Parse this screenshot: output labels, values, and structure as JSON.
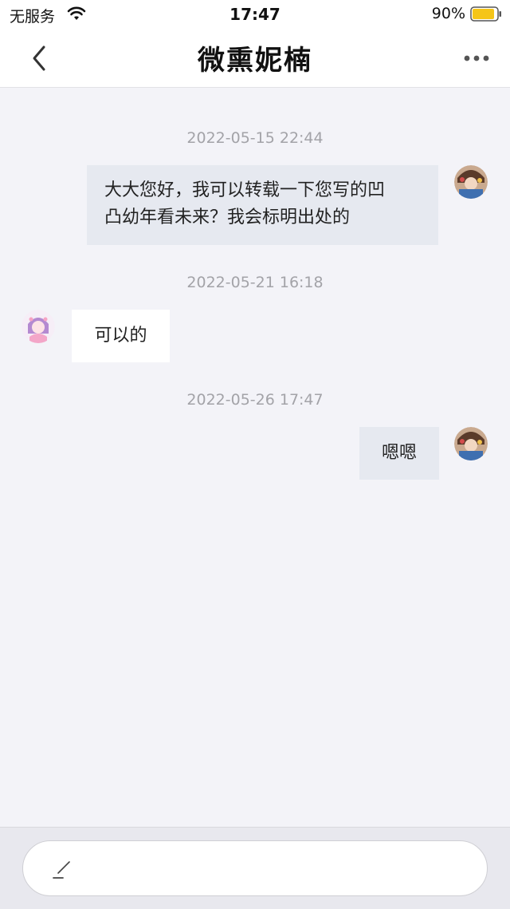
{
  "status_bar": {
    "carrier": "无服务",
    "time": "17:47",
    "battery_percent": "90%",
    "battery_level": 0.9,
    "battery_color": "#f5c518"
  },
  "nav": {
    "title": "微熏妮楠",
    "back_icon": "chevron-left-icon",
    "more_icon": "ellipsis-icon"
  },
  "messages": [
    {
      "timestamp": "2022-05-15 22:44",
      "direction": "out",
      "lines": [
        "大大您好，我可以转载一下您写的凹",
        "凸幼年看未来？我会标明出处的"
      ]
    },
    {
      "timestamp": "2022-05-21 16:18",
      "direction": "in",
      "lines": [
        "可以的"
      ]
    },
    {
      "timestamp": "2022-05-26 17:47",
      "direction": "out",
      "lines": [
        "嗯嗯"
      ]
    }
  ],
  "input": {
    "icon": "pen-icon"
  },
  "colors": {
    "background": "#f3f3f8",
    "outgoing_bubble": "#e6e9f0",
    "incoming_bubble": "#ffffff",
    "timestamp": "#a3a3a8"
  }
}
